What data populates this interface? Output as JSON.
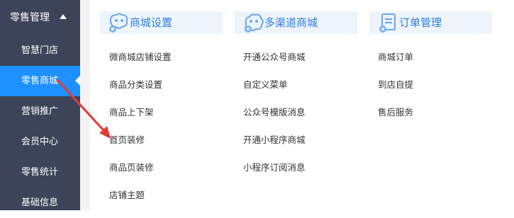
{
  "sidebar": {
    "header": "零售管理",
    "items": [
      "智慧门店",
      "零售商城",
      "营销推广",
      "会员中心",
      "零售统计",
      "基础信息"
    ],
    "active_index": 1
  },
  "columns": [
    {
      "title": "商城设置",
      "icon": "store-settings-icon",
      "links": [
        "微商城店铺设置",
        "商品分类设置",
        "商品上下架",
        "首页装修",
        "商品页装修",
        "店铺主题"
      ]
    },
    {
      "title": "多渠道商城",
      "icon": "multichannel-icon",
      "links": [
        "开通公众号商城",
        "自定义菜单",
        "公众号模版消息",
        "开通小程序商城",
        "小程序订阅消息"
      ]
    },
    {
      "title": "订单管理",
      "icon": "order-management-icon",
      "links": [
        "商城订单",
        "到店自提",
        "售后服务"
      ]
    }
  ],
  "colors": {
    "sidebar_bg": "#3d4358",
    "active_bg": "#1e90ff",
    "heading_text": "#2f7fe0",
    "heading_bg": "#eef4fb",
    "annotation_arrow": "#e53935"
  }
}
